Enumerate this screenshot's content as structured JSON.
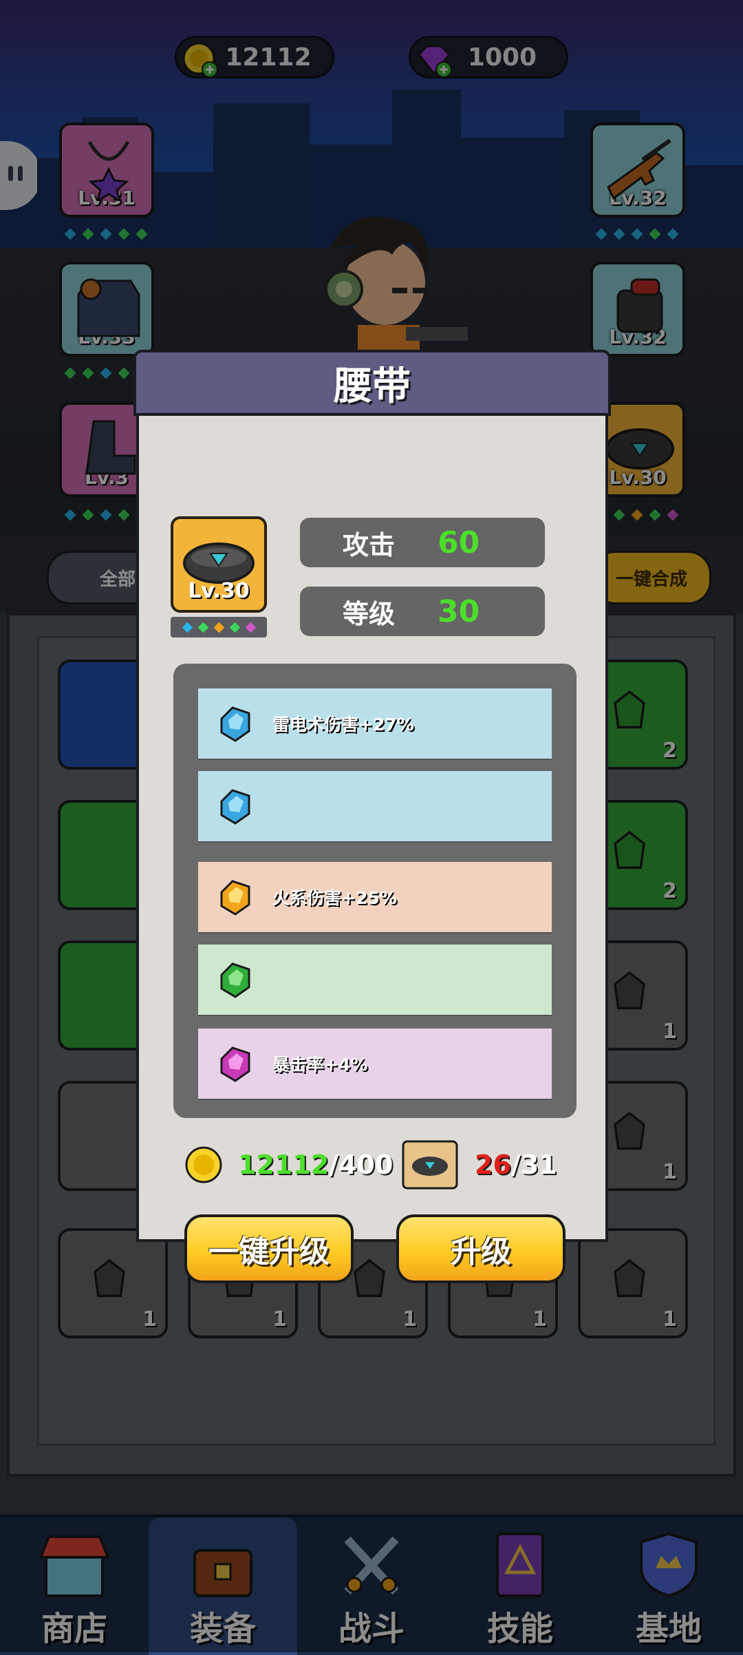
{
  "currencies": {
    "gold": "12112",
    "gems": "1000"
  },
  "equipment_slots": [
    {
      "name": "necklace",
      "level": "Lv.31"
    },
    {
      "name": "rifle",
      "level": "Lv.32"
    },
    {
      "name": "armor",
      "level": "Lv.33"
    },
    {
      "name": "gloves",
      "level": "Lv.32"
    },
    {
      "name": "boots",
      "level": "Lv.3"
    },
    {
      "name": "belt",
      "level": "Lv.30"
    }
  ],
  "filters": {
    "all_label": "全部",
    "merge_label": "一键合成"
  },
  "inventory_counts": [
    "2",
    "2",
    "1",
    "1",
    "1",
    "1",
    "1",
    "1",
    "1"
  ],
  "modal": {
    "title": "腰带",
    "item_level": "Lv.30",
    "stats": [
      {
        "label": "攻击",
        "value": "60"
      },
      {
        "label": "等级",
        "value": "30"
      }
    ],
    "attributes": [
      {
        "gem": "blue-gem-icon",
        "color": "#b9e0ea",
        "text": "雷电术伤害+27%"
      },
      {
        "gem": "blue-gem-icon",
        "color": "#b9e0ea",
        "text": ""
      },
      {
        "gem": "orange-gem-icon",
        "color": "#f2d2bf",
        "text": "火系伤害+25%"
      },
      {
        "gem": "green-gem-icon",
        "color": "#cde7d0",
        "text": ""
      },
      {
        "gem": "purple-gem-icon",
        "color": "#e8d2e8",
        "text": "暴击率+4%"
      }
    ],
    "gold_cost": {
      "have": "12112",
      "need": "/400"
    },
    "material_cost": {
      "have": "26",
      "need": "/31"
    },
    "one_click_upgrade": "一键升级",
    "upgrade": "升级"
  },
  "nav": [
    {
      "label": "商店",
      "icon": "shop-icon"
    },
    {
      "label": "装备",
      "icon": "chest-icon"
    },
    {
      "label": "战斗",
      "icon": "swords-icon"
    },
    {
      "label": "技能",
      "icon": "skill-book-icon"
    },
    {
      "label": "基地",
      "icon": "base-shield-icon"
    }
  ],
  "colors": {
    "stat_value": "#4cdf2a",
    "material_have": "#e0201a",
    "gold_have": "#4cdf2a",
    "nav_active": "#2f4b80"
  }
}
